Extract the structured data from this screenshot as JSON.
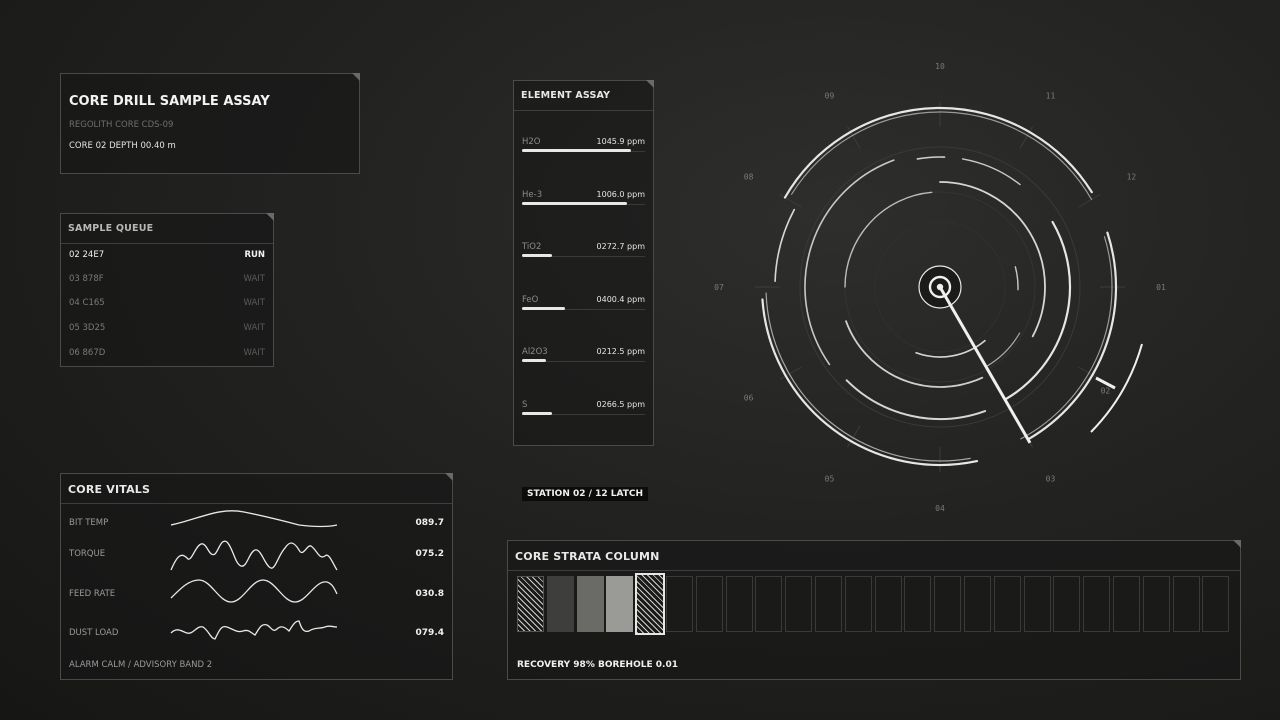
{
  "header": {
    "title": "CORE DRILL SAMPLE ASSAY",
    "subtitle": "REGOLITH CORE  CDS-09",
    "core_depth": "CORE 02  DEPTH 00.40 m"
  },
  "queue": {
    "title": "SAMPLE QUEUE",
    "items": [
      {
        "id": "02  24E7",
        "status": "RUN"
      },
      {
        "id": "03  878F",
        "status": "WAIT"
      },
      {
        "id": "04  C165",
        "status": "WAIT"
      },
      {
        "id": "05  3D25",
        "status": "WAIT"
      },
      {
        "id": "06  867D",
        "status": "WAIT"
      }
    ]
  },
  "assay": {
    "title": "ELEMENT ASSAY",
    "items": [
      {
        "name": "H2O",
        "value": "1045.9 ppm",
        "level": 0.88
      },
      {
        "name": "He-3",
        "value": "1006.0 ppm",
        "level": 0.85
      },
      {
        "name": "TiO2",
        "value": "0272.7 ppm",
        "level": 0.24
      },
      {
        "name": "FeO",
        "value": "0400.4 ppm",
        "level": 0.35
      },
      {
        "name": "Al2O3",
        "value": "0212.5 ppm",
        "level": 0.19
      },
      {
        "name": "S",
        "value": "0266.5 ppm",
        "level": 0.24
      }
    ]
  },
  "vitals": {
    "title": "CORE VITALS",
    "items": [
      {
        "label": "BIT TEMP",
        "value": "089.7"
      },
      {
        "label": "TORQUE",
        "value": "075.2"
      },
      {
        "label": "FEED RATE",
        "value": "030.8"
      },
      {
        "label": "DUST LOAD",
        "value": "079.4"
      }
    ],
    "footer": "ALARM  CALM / ADVISORY BAND 2"
  },
  "station": "STATION 02 / 12   LATCH",
  "dial": {
    "labels": [
      "10",
      "11",
      "12",
      "01",
      "02",
      "03",
      "04",
      "05",
      "06",
      "07",
      "08",
      "09"
    ],
    "selected": "02",
    "hand_position": 2.5
  },
  "strata": {
    "title": "CORE STRATA COLUMN",
    "cell_count": 24,
    "filled": [
      "hatch",
      "solid1",
      "solid2",
      "solid3",
      "hatch-selected"
    ],
    "footer": "RECOVERY 98%   BOREHOLE 0.01"
  },
  "colors": {
    "background": "#1e1e1d",
    "foreground": "#e8e8e6",
    "panel_border": "#4a4a48",
    "dim_text": "#7d7d7a"
  }
}
